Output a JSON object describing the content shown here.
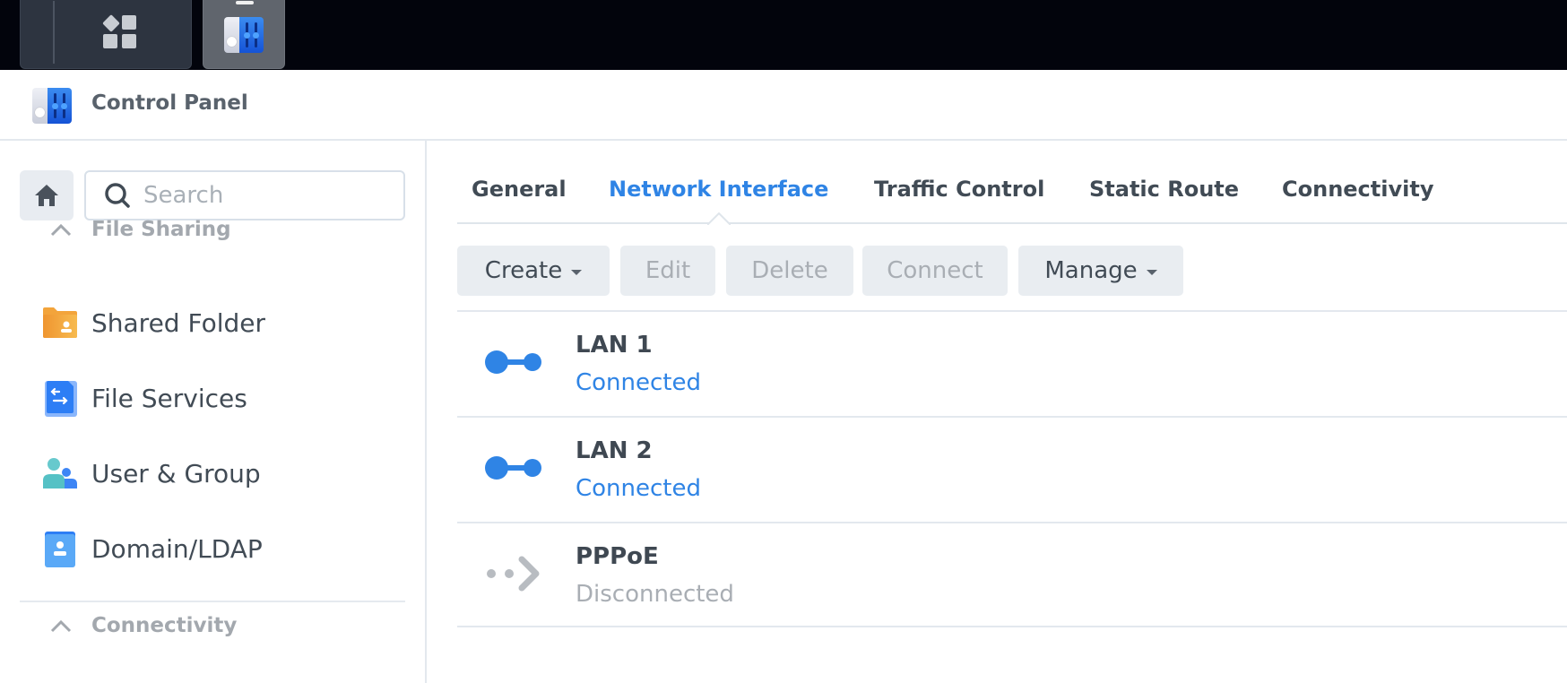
{
  "taskbar": {
    "items": [
      {
        "name": "main-menu",
        "icon": "grid-icon"
      },
      {
        "name": "control-panel",
        "icon": "control-panel-icon",
        "active": true
      }
    ]
  },
  "window": {
    "title": "Control Panel",
    "icon": "control-panel-icon"
  },
  "sidebar": {
    "home_icon": "home-icon",
    "search": {
      "placeholder": "Search",
      "value": ""
    },
    "sections": [
      {
        "label": "File Sharing",
        "expanded": true,
        "items": [
          {
            "label": "Shared Folder",
            "icon": "shared-folder-icon"
          },
          {
            "label": "File Services",
            "icon": "file-services-icon"
          },
          {
            "label": "User & Group",
            "icon": "user-group-icon"
          },
          {
            "label": "Domain/LDAP",
            "icon": "domain-ldap-icon"
          }
        ]
      },
      {
        "label": "Connectivity",
        "expanded": true,
        "items": []
      }
    ]
  },
  "main": {
    "tabs": [
      {
        "label": "General",
        "active": false
      },
      {
        "label": "Network Interface",
        "active": true
      },
      {
        "label": "Traffic Control",
        "active": false
      },
      {
        "label": "Static Route",
        "active": false
      },
      {
        "label": "Connectivity",
        "active": false
      }
    ],
    "toolbar": {
      "create": {
        "label": "Create",
        "enabled": true,
        "dropdown": true
      },
      "edit": {
        "label": "Edit",
        "enabled": false
      },
      "delete": {
        "label": "Delete",
        "enabled": false
      },
      "connect": {
        "label": "Connect",
        "enabled": false
      },
      "manage": {
        "label": "Manage",
        "enabled": true,
        "dropdown": true
      }
    },
    "interfaces": [
      {
        "name": "LAN 1",
        "status": "Connected",
        "icon": "lan-connected-icon"
      },
      {
        "name": "LAN 2",
        "status": "Connected",
        "icon": "lan-connected-icon"
      },
      {
        "name": "PPPoE",
        "status": "Disconnected",
        "icon": "pppoe-disconnected-icon"
      }
    ]
  },
  "colors": {
    "accent": "#2f84e5",
    "text": "#414b55",
    "muted": "#a9aeb4",
    "button_bg": "#e9edf1",
    "taskbar_bg": "#02040c"
  }
}
